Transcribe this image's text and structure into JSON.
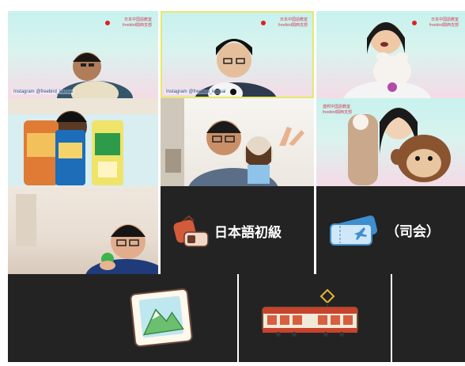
{
  "participants": [
    {
      "id": "p1",
      "brand_line1": "日本中国語教室",
      "brand_line2": "freebird関西支部",
      "tag": "Instagram @freebird_kansai",
      "kind": "video"
    },
    {
      "id": "p2",
      "brand_line1": "日本中国語教室",
      "brand_line2": "freebird関西支部",
      "tag": "Instagram @freebird_kansai",
      "kind": "video",
      "active": true
    },
    {
      "id": "p3",
      "brand_line1": "日本中国語教室",
      "brand_line2": "freebird関西支部",
      "tag": "",
      "kind": "video"
    },
    {
      "id": "p4",
      "brand_line1": "",
      "brand_line2": "",
      "tag": "",
      "kind": "video"
    },
    {
      "id": "p5",
      "brand_line1": "",
      "brand_line2": "",
      "tag": "",
      "kind": "video"
    },
    {
      "id": "p6",
      "brand_line1": "連邦中国語教室",
      "brand_line2": "freebird関西支部",
      "tag": "",
      "kind": "video"
    },
    {
      "id": "p7",
      "brand_line1": "",
      "brand_line2": "",
      "tag": "",
      "kind": "video"
    },
    {
      "id": "p8",
      "name": "日本語初級",
      "icon": "luggage-icon",
      "kind": "avatar"
    },
    {
      "id": "p9",
      "name": "（司会）",
      "icon": "ticket-icon",
      "kind": "avatar"
    },
    {
      "id": "p10",
      "name": "",
      "icon": "picture-icon",
      "kind": "avatar"
    },
    {
      "id": "p11",
      "name": "",
      "icon": "tram-icon",
      "kind": "avatar"
    }
  ],
  "colors": {
    "tile_dark": "#232323",
    "active_border": "#e7e86a",
    "brand_red": "#d63a55"
  }
}
